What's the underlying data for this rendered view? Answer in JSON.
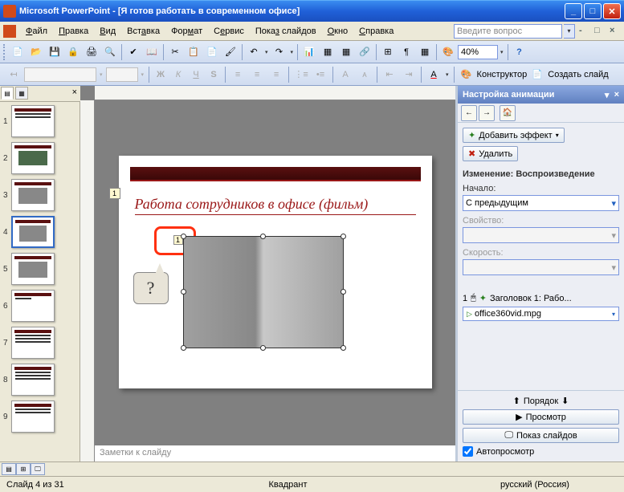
{
  "titlebar": {
    "app": "Microsoft PowerPoint",
    "doc": "[Я готов работать в современном офисе]"
  },
  "menu": {
    "file": "Файл",
    "edit": "Правка",
    "view": "Вид",
    "insert": "Вставка",
    "format": "Формат",
    "tools": "Сервис",
    "slideshow": "Показ слайдов",
    "window": "Окно",
    "help": "Справка",
    "ask": "Введите вопрос"
  },
  "toolbar": {
    "zoom": "40%",
    "designer": "Конструктор",
    "newslide": "Создать слайд"
  },
  "thumbs": {
    "count": 9,
    "selected": 4
  },
  "slide": {
    "title": "Работа сотрудников в офисе (фильм)",
    "tag1": "1",
    "tag2": "1",
    "callout": "?"
  },
  "notes": {
    "placeholder": "Заметки к слайду"
  },
  "taskpane": {
    "title": "Настройка анимации",
    "add_effect": "Добавить эффект",
    "remove": "Удалить",
    "change_label": "Изменение: Воспроизведение",
    "start_label": "Начало:",
    "start_value": "С предыдущим",
    "property_label": "Свойство:",
    "speed_label": "Скорость:",
    "item1_num": "1",
    "item1_label": "Заголовок 1: Рабо...",
    "item2_file": "office360vid.mpg",
    "order": "Порядок",
    "preview": "Просмотр",
    "slideshow": "Показ слайдов",
    "autopreview": "Автопросмотр"
  },
  "status": {
    "slide": "Слайд 4 из 31",
    "template": "Квадрант",
    "lang": "русский (Россия)"
  }
}
